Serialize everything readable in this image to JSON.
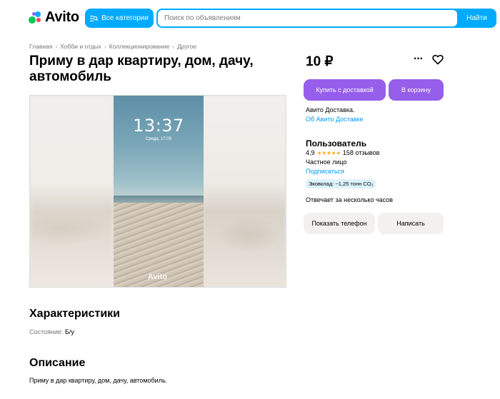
{
  "header": {
    "logo_text": "Avito",
    "categories_label": "Все категории",
    "search_placeholder": "Поиск по объявлениям",
    "search_button": "Найти"
  },
  "breadcrumb": [
    "Главная",
    "Хобби и отдых",
    "Коллекционирование",
    "Другое"
  ],
  "listing": {
    "title": "Приму в дар квартиру, дом, дачу, автомобиль",
    "price": "10 ₽",
    "image": {
      "time": "13:37",
      "date": "Среда, 17.09",
      "watermark": "Avito"
    }
  },
  "actions": {
    "buy_label": "Купить с доставкой",
    "cart_label": "В корзину",
    "delivery_text": "Авито Доставка.",
    "delivery_link": "Об Авито Доставке"
  },
  "seller": {
    "name": "Пользователь",
    "rating": "4,9",
    "stars": 5,
    "reviews": "158 отзывов",
    "type": "Частное лицо",
    "subscribe": "Подписаться",
    "eco": "Эковклад: ~1,25 тонн CO₂",
    "response": "Отвечает за несколько часов",
    "show_phone": "Показать телефон",
    "write": "Написать"
  },
  "characteristics": {
    "heading": "Характеристики",
    "state_key": "Состояние:",
    "state_value": "Б/у"
  },
  "description": {
    "heading": "Описание",
    "text": "Приму в дар квартиру, дом, дачу, автомобиль."
  },
  "colors": {
    "accent_blue": "#00aaff",
    "purple": "#965eeb",
    "link": "#0099f7",
    "star": "#ffb021"
  }
}
